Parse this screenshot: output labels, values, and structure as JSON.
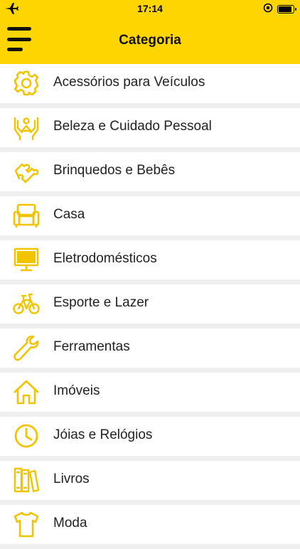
{
  "status_bar": {
    "time": "17:14"
  },
  "header": {
    "title": "Categoria"
  },
  "categories": [
    {
      "label": "Acessórios para Veículos",
      "icon": "gear-icon"
    },
    {
      "label": "Beleza e Cuidado Pessoal",
      "icon": "hands-person-icon"
    },
    {
      "label": "Brinquedos e Bebês",
      "icon": "puzzle-icon"
    },
    {
      "label": "Casa",
      "icon": "armchair-icon"
    },
    {
      "label": "Eletrodomésticos",
      "icon": "monitor-icon"
    },
    {
      "label": "Esporte e Lazer",
      "icon": "bicycle-icon"
    },
    {
      "label": "Ferramentas",
      "icon": "wrench-icon"
    },
    {
      "label": "Imóveis",
      "icon": "house-icon"
    },
    {
      "label": "Jóias e Relógios",
      "icon": "clock-icon"
    },
    {
      "label": "Livros",
      "icon": "books-icon"
    },
    {
      "label": "Moda",
      "icon": "tshirt-icon"
    }
  ],
  "colors": {
    "accent": "#ffd500",
    "icon": "#f2c400",
    "text": "#222222",
    "background": "#efefef"
  }
}
